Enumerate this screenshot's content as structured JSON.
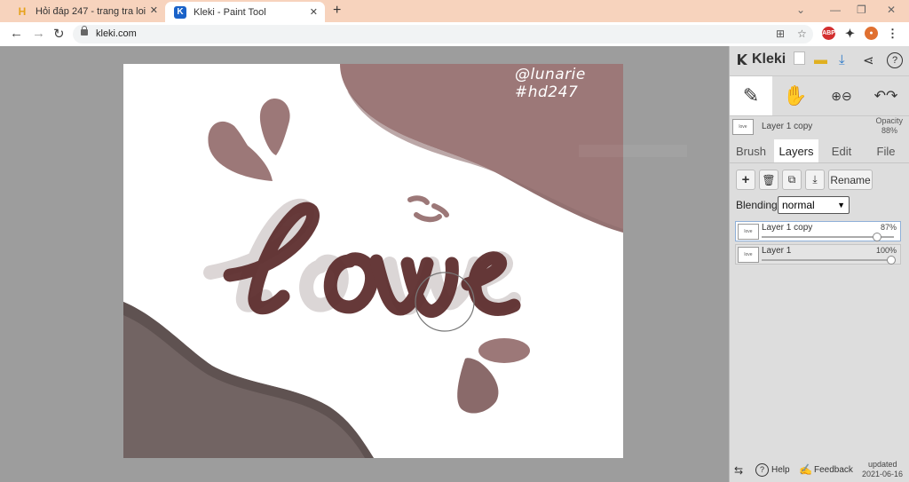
{
  "browser": {
    "tabs": [
      {
        "title": "Hỏi đáp 247 - trang tra loi",
        "favicon": "H"
      },
      {
        "title": "Kleki - Paint Tool",
        "favicon": "K"
      }
    ],
    "new_tab": "+",
    "url": "kleki.com"
  },
  "canvas": {
    "tag_line1": "@lunarie",
    "tag_line2": "#hd247",
    "word": "love",
    "colors": {
      "dusty_rose": "#9c7878",
      "dark_brown": "#5e2f2f",
      "gray_brown": "#726463",
      "mauve": "#8a6a6a",
      "ghost": "#d8d2d2"
    }
  },
  "panel": {
    "app_name": "Kleki",
    "layer_header": {
      "name": "Layer 1 copy",
      "opacity_label": "Opacity",
      "opacity_value": "88%"
    },
    "tabs": [
      "Brush",
      "Layers",
      "Edit",
      "File"
    ],
    "active_tab": "Layers",
    "rename_label": "Rename",
    "blending_label": "Blending",
    "blending_value": "normal",
    "layers": [
      {
        "name": "Layer 1 copy",
        "opacity": "87%",
        "opacity_frac": 0.87,
        "selected": true
      },
      {
        "name": "Layer 1",
        "opacity": "100%",
        "opacity_frac": 1.0,
        "selected": false
      }
    ],
    "footer": {
      "help": "Help",
      "feedback": "Feedback",
      "updated_label": "updated",
      "updated_date": "2021-06-16"
    }
  }
}
